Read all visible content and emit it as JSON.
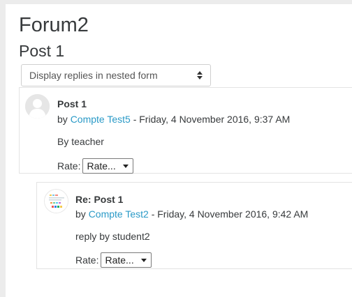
{
  "forum": {
    "title": "Forum2"
  },
  "discussion": {
    "title": "Post 1"
  },
  "display_mode": {
    "selected": "Display replies in nested form"
  },
  "posts": [
    {
      "subject": "Post 1",
      "by_prefix": "by",
      "author": "Compte Test5",
      "date": " - Friday, 4 November 2016, 9:37 AM",
      "message": "By teacher",
      "rate_label": "Rate:",
      "rate_value": "Rate..."
    },
    {
      "subject": "Re: Post 1",
      "by_prefix": "by",
      "author": "Compte Test2",
      "date": " - Friday, 4 November 2016, 9:42 AM",
      "message": "reply by student2",
      "rate_label": "Rate:",
      "rate_value": "Rate..."
    }
  ]
}
